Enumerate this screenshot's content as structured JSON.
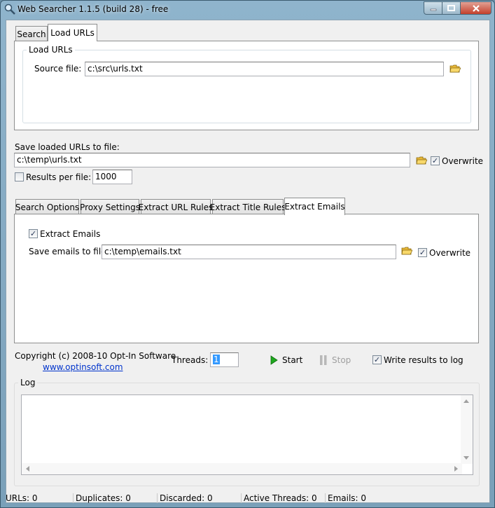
{
  "window": {
    "title": "Web Searcher 1.1.5 (build 28) - free"
  },
  "main_tabs": {
    "search": "Search",
    "load_urls": "Load URLs"
  },
  "load_urls_group": {
    "legend": "Load URLs",
    "source_label": "Source file:",
    "source_value": "c:\\src\\urls.txt"
  },
  "save": {
    "label": "Save loaded URLs to file:",
    "value": "c:\\temp\\urls.txt",
    "overwrite_label": "Overwrite",
    "overwrite_checked": true,
    "results_per_file_label": "Results per file:",
    "results_per_file_checked": false,
    "results_per_file_value": "1000"
  },
  "sub_tabs": [
    "Search Options",
    "Proxy Settings",
    "Extract URL Rules",
    "Extract Title Rules",
    "Extract Emails"
  ],
  "extract_emails": {
    "checkbox_label": "Extract Emails",
    "checked": true,
    "save_label": "Save emails to file:",
    "save_value": "c:\\temp\\emails.txt",
    "overwrite_label": "Overwrite",
    "overwrite_checked": true
  },
  "footer": {
    "copyright": "Copyright (c) 2008-10 Opt-In Software",
    "website": "www.optinsoft.com",
    "threads_label": "Threads:",
    "threads_value": "1",
    "start_label": "Start",
    "stop_label": "Stop",
    "write_log_label": "Write results to log",
    "write_log_checked": true
  },
  "log": {
    "legend": "Log"
  },
  "status_bar": {
    "urls": "URLs: 0",
    "duplicates": "Duplicates: 0",
    "discarded": "Discarded: 0",
    "active_threads": "Active Threads: 0",
    "emails": "Emails: 0"
  },
  "icons": {
    "app": "magnifier-icon",
    "browse": "folder-open-icon",
    "start": "play-icon",
    "stop": "pause-icon"
  },
  "colors": {
    "link": "#0033cc",
    "start_green": "#1fa81f",
    "stop_disabled": "#a0a0a0",
    "close_button": "#c4402c"
  }
}
